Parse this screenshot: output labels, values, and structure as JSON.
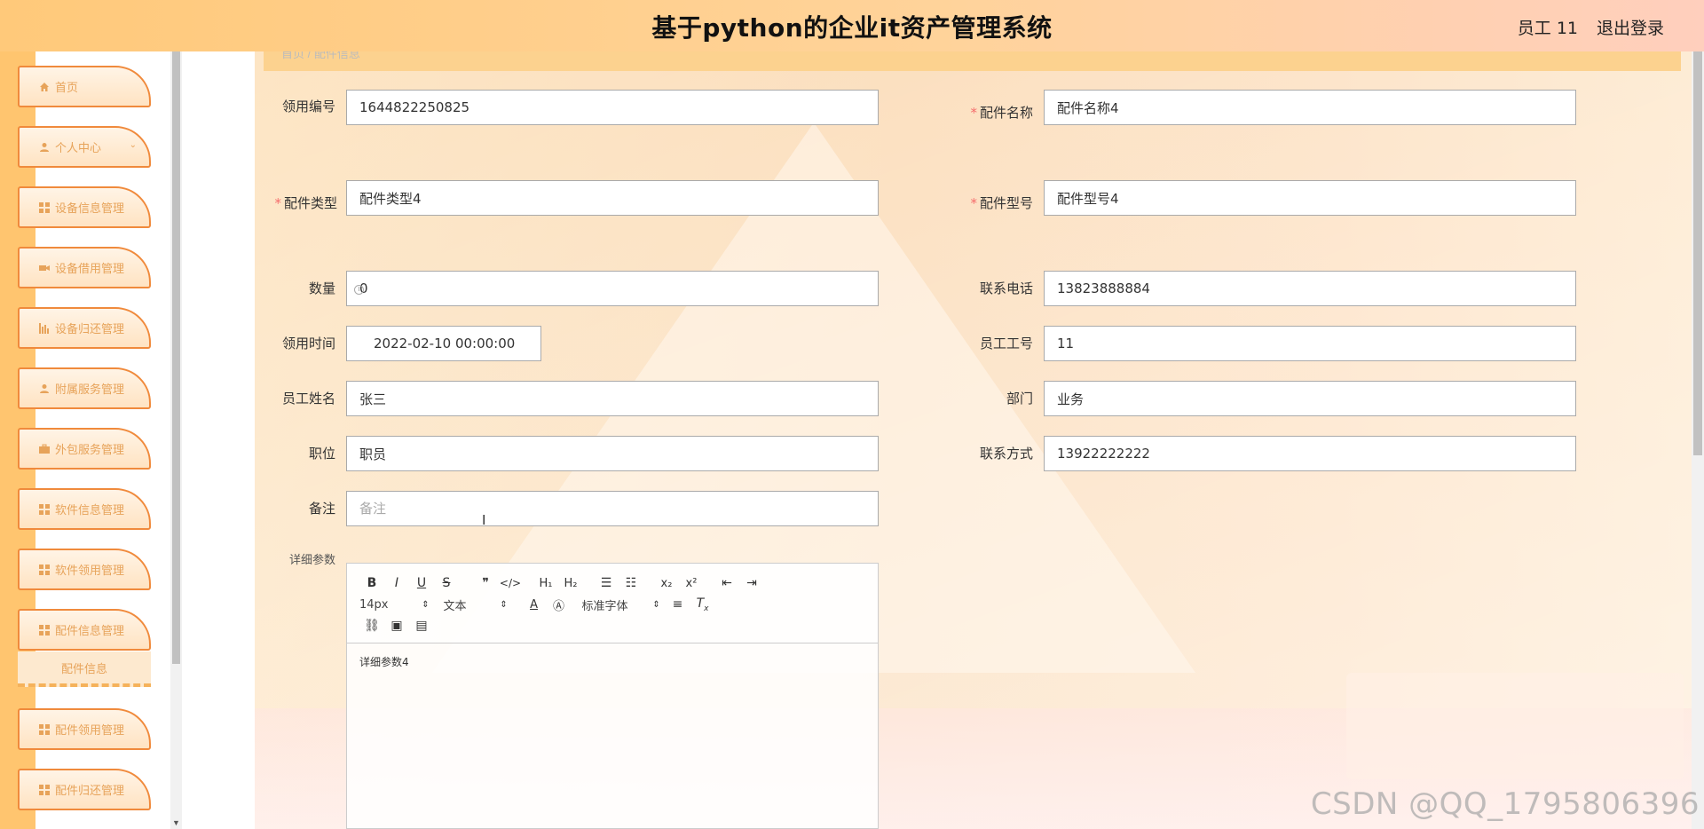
{
  "header": {
    "title": "基于python的企业it资产管理系统",
    "user": "员工 11",
    "logout": "退出登录"
  },
  "sidebar": {
    "items": [
      {
        "label": "首页",
        "icon": "home-icon"
      },
      {
        "label": "个人中心",
        "icon": "user-icon"
      },
      {
        "label": "设备信息管理",
        "icon": "grid-icon"
      },
      {
        "label": "设备借用管理",
        "icon": "camera-icon"
      },
      {
        "label": "设备归还管理",
        "icon": "chart-icon"
      },
      {
        "label": "附属服务管理",
        "icon": "user-icon"
      },
      {
        "label": "外包服务管理",
        "icon": "briefcase-icon"
      },
      {
        "label": "软件信息管理",
        "icon": "grid-icon"
      },
      {
        "label": "软件领用管理",
        "icon": "grid-icon"
      },
      {
        "label": "配件信息管理",
        "icon": "grid-icon"
      },
      {
        "label": "配件领用管理",
        "icon": "grid-icon"
      },
      {
        "label": "配件归还管理",
        "icon": "grid-icon"
      }
    ],
    "sub_item": "配件信息"
  },
  "breadcrumb": "首页 / 配件信息",
  "form": {
    "receive_no_label": "领用编号",
    "receive_no": "1644822250825",
    "part_name_label": "配件名称",
    "part_name": "配件名称4",
    "part_type_label": "配件类型",
    "part_type": "配件类型4",
    "part_model_label": "配件型号",
    "part_model": "配件型号4",
    "quantity_label": "数量",
    "quantity": "0",
    "phone_label": "联系电话",
    "phone": "13823888884",
    "receive_time_label": "领用时间",
    "receive_time": "2022-02-10 00:00:00",
    "emp_no_label": "员工工号",
    "emp_no": "11",
    "emp_name_label": "员工姓名",
    "emp_name": "张三",
    "dept_label": "部门",
    "dept": "业务",
    "position_label": "职位",
    "position": "职员",
    "contact_label": "联系方式",
    "contact": "13922222222",
    "remark_label": "备注",
    "remark_placeholder": "备注",
    "detail_label": "详细参数",
    "detail_content": "详细参数4"
  },
  "editor": {
    "font_size": "14px",
    "block_type": "文本",
    "font_family": "标准字体"
  },
  "watermark": "CSDN @QQ_1795806396"
}
